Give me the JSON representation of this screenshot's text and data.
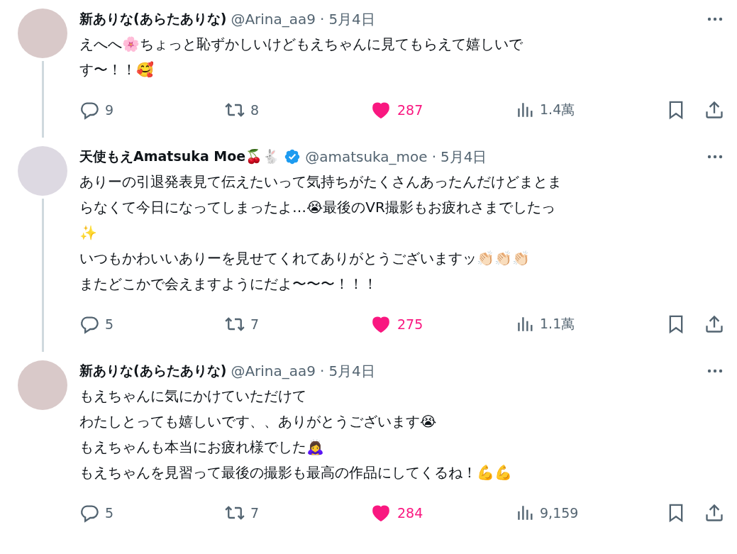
{
  "tweets": [
    {
      "name": "新ありな(あらたありな)",
      "verified": false,
      "handle": "@Arina_aa9",
      "separator": "·",
      "date": "5月4日",
      "lines": [
        "えへへ🌸ちょっと恥ずかしいけどもえちゃんに見てもらえて嬉しいで",
        "す〜！！🥰"
      ],
      "replies": "9",
      "retweets": "8",
      "likes": "287",
      "liked": true,
      "views": "1.4萬",
      "thread_line": true
    },
    {
      "name": "天使もえAmatsuka Moe🍒🐇",
      "verified": true,
      "handle": "@amatsuka_moe",
      "separator": "·",
      "date": "5月4日",
      "lines": [
        "ありーの引退発表見て伝えたいって気持ちがたくさんあったんだけどまとま",
        "らなくて今日になってしまったよ…😭最後のVR撮影もお疲れさまでしたっ",
        "✨",
        "いつもかわいいありーを見せてくれてありがとうございますッ👏🏻👏🏻👏🏻",
        "またどこかで会えますようにだよ〜〜〜！！！"
      ],
      "replies": "5",
      "retweets": "7",
      "likes": "275",
      "liked": true,
      "views": "1.1萬",
      "thread_line": true
    },
    {
      "name": "新ありな(あらたありな)",
      "verified": false,
      "handle": "@Arina_aa9",
      "separator": "·",
      "date": "5月4日",
      "lines": [
        "もえちゃんに気にかけていただけて",
        "わたしとっても嬉しいです、、ありがとうございます😭",
        "もえちゃんも本当にお疲れ様でした🙇‍♀️",
        "もえちゃんを見習って最後の撮影も最高の作品にしてくるね！💪💪"
      ],
      "replies": "5",
      "retweets": "7",
      "likes": "284",
      "liked": true,
      "views": "9,159",
      "thread_line": false
    }
  ]
}
